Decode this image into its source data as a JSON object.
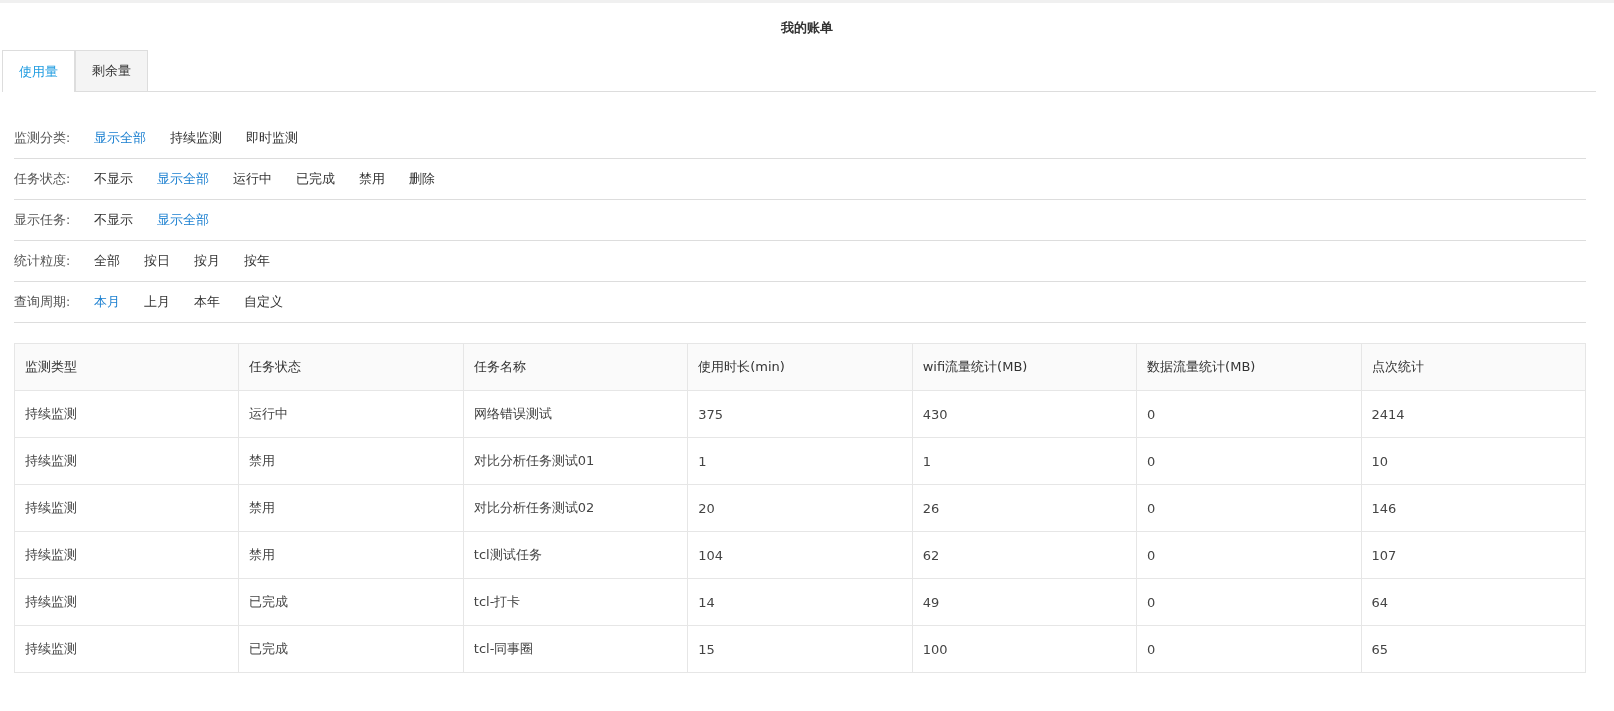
{
  "page": {
    "title": "我的账单"
  },
  "tabs": [
    {
      "label": "使用量",
      "selected": true
    },
    {
      "label": "剩余量",
      "selected": false
    }
  ],
  "filters": [
    {
      "label": "监测分类:",
      "options": [
        {
          "label": "显示全部",
          "selected": true
        },
        {
          "label": "持续监测",
          "selected": false
        },
        {
          "label": "即时监测",
          "selected": false
        }
      ]
    },
    {
      "label": "任务状态:",
      "options": [
        {
          "label": "不显示",
          "selected": false
        },
        {
          "label": "显示全部",
          "selected": true
        },
        {
          "label": "运行中",
          "selected": false
        },
        {
          "label": "已完成",
          "selected": false
        },
        {
          "label": "禁用",
          "selected": false
        },
        {
          "label": "删除",
          "selected": false
        }
      ]
    },
    {
      "label": "显示任务:",
      "options": [
        {
          "label": "不显示",
          "selected": false
        },
        {
          "label": "显示全部",
          "selected": true
        }
      ]
    },
    {
      "label": "统计粒度:",
      "options": [
        {
          "label": "全部",
          "selected": false
        },
        {
          "label": "按日",
          "selected": false
        },
        {
          "label": "按月",
          "selected": false
        },
        {
          "label": "按年",
          "selected": false
        }
      ]
    },
    {
      "label": "查询周期:",
      "options": [
        {
          "label": "本月",
          "selected": true
        },
        {
          "label": "上月",
          "selected": false
        },
        {
          "label": "本年",
          "selected": false
        },
        {
          "label": "自定义",
          "selected": false
        }
      ]
    }
  ],
  "table": {
    "columns": [
      "监测类型",
      "任务状态",
      "任务名称",
      "使用时长(min)",
      "wifi流量统计(MB)",
      "数据流量统计(MB)",
      "点次统计"
    ],
    "rows": [
      [
        "持续监测",
        "运行中",
        "网络错误测试",
        "375",
        "430",
        "0",
        "2414"
      ],
      [
        "持续监测",
        "禁用",
        "对比分析任务测试01",
        "1",
        "1",
        "0",
        "10"
      ],
      [
        "持续监测",
        "禁用",
        "对比分析任务测试02",
        "20",
        "26",
        "0",
        "146"
      ],
      [
        "持续监测",
        "禁用",
        "tcl测试任务",
        "104",
        "62",
        "0",
        "107"
      ],
      [
        "持续监测",
        "已完成",
        "tcl-打卡",
        "14",
        "49",
        "0",
        "64"
      ],
      [
        "持续监测",
        "已完成",
        "tcl-同事圈",
        "15",
        "100",
        "0",
        "65"
      ]
    ]
  }
}
